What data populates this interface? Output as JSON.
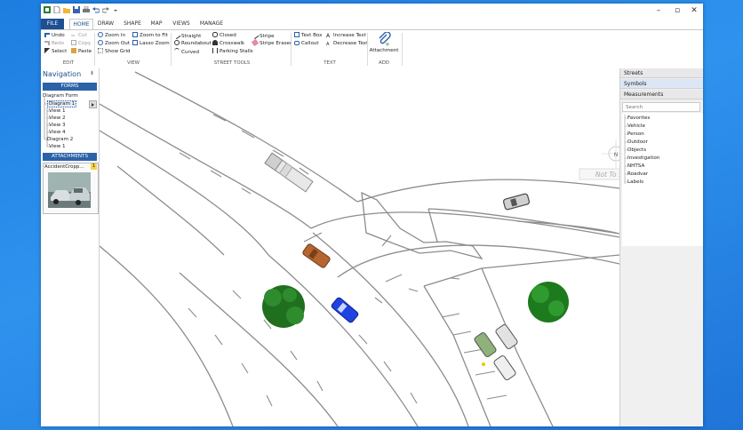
{
  "ribbon": {
    "tabs": [
      {
        "label": "FILE"
      },
      {
        "label": "HOME"
      },
      {
        "label": "DRAW"
      },
      {
        "label": "SHAPE"
      },
      {
        "label": "MAP"
      },
      {
        "label": "VIEWS"
      },
      {
        "label": "MANAGE"
      }
    ],
    "edit": {
      "undo": "Undo",
      "redo": "Redo",
      "cut": "Cut",
      "copy": "Copy",
      "select": "Select",
      "paste": "Paste",
      "group": "EDIT"
    },
    "view": {
      "zoom_in": "Zoom In",
      "zoom_out": "Zoom Out",
      "show_grid": "Show Grid",
      "zoom_to_fit": "Zoom to Fit",
      "lasso_zoom": "Lasso Zoom",
      "group": "VIEW"
    },
    "street_tools": {
      "straight": "Straight",
      "roundabout": "Roundabout",
      "curved": "Curved",
      "closed": "Closed",
      "crosswalk": "Crosswalk",
      "parking_stalls": "Parking Stalls",
      "stripe": "Stripe",
      "stripe_eraser": "Stripe Eraser",
      "group": "STREET TOOLS"
    },
    "text": {
      "text_box": "Text Box",
      "callout": "Callout",
      "increase_text": "Increase Text",
      "decrease_text": "Decrease Text",
      "group": "TEXT"
    },
    "add": {
      "attachment": "Attachment",
      "group": "ADD"
    }
  },
  "navigation": {
    "title": "Navigation",
    "pin": "⇟",
    "forms_label": "FORMS",
    "tree": [
      {
        "label": "Diagram Form"
      },
      {
        "label": "Diagram 1"
      },
      {
        "label": "View 1"
      },
      {
        "label": "View 2"
      },
      {
        "label": "View 3"
      },
      {
        "label": "View 4"
      },
      {
        "label": "Diagram 2"
      },
      {
        "label": "View 1"
      }
    ],
    "attachments_label": "ATTACHMENTS",
    "attachment_name": "AccidentCropp...",
    "attachment_count": "1"
  },
  "canvas": {
    "scale_note": "Not To Scale",
    "north": "N"
  },
  "right_panel": {
    "streets": "Streets",
    "symbols": "Symbols",
    "measurements": "Measurements",
    "search_placeholder": "Search",
    "items": [
      {
        "label": "Favorites"
      },
      {
        "label": "Vehicle"
      },
      {
        "label": "Person"
      },
      {
        "label": "Outdoor"
      },
      {
        "label": "Objects"
      },
      {
        "label": "Investigation"
      },
      {
        "label": "NHTSA"
      },
      {
        "label": "Roadvar"
      },
      {
        "label": "Labels"
      }
    ]
  },
  "colors": {
    "accent": "#1d4f91",
    "nav_bar": "#2c62a8",
    "symbols_bg": "#dce6f4",
    "desktop": "#2a89e8"
  }
}
